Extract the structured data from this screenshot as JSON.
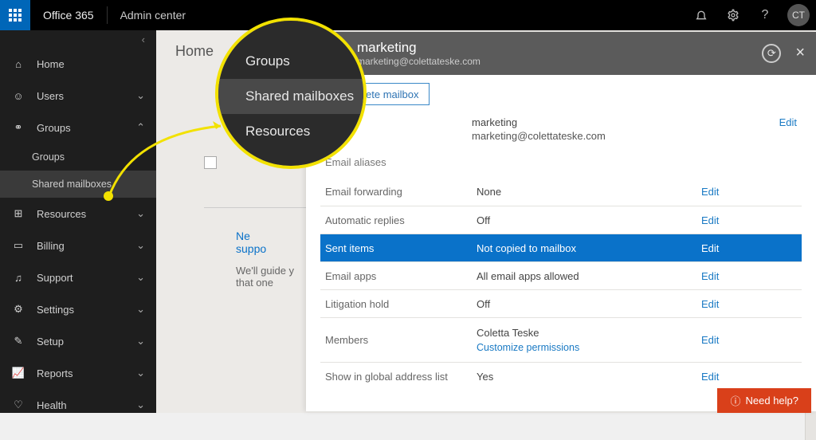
{
  "topbar": {
    "brand": "Office 365",
    "subtitle": "Admin center",
    "avatar_initials": "CT"
  },
  "sidebar": {
    "items": [
      {
        "icon": "home-icon",
        "label": "Home",
        "expandable": false
      },
      {
        "icon": "users-icon",
        "label": "Users",
        "expandable": true,
        "expanded": false
      },
      {
        "icon": "groups-icon",
        "label": "Groups",
        "expandable": true,
        "expanded": true,
        "children": [
          {
            "label": "Groups",
            "selected": false
          },
          {
            "label": "Shared mailboxes",
            "selected": true
          }
        ]
      },
      {
        "icon": "resources-icon",
        "label": "Resources",
        "expandable": true
      },
      {
        "icon": "billing-icon",
        "label": "Billing",
        "expandable": true
      },
      {
        "icon": "support-icon",
        "label": "Support",
        "expandable": true
      },
      {
        "icon": "settings-icon",
        "label": "Settings",
        "expandable": true
      },
      {
        "icon": "setup-icon",
        "label": "Setup",
        "expandable": true
      },
      {
        "icon": "reports-icon",
        "label": "Reports",
        "expandable": true
      },
      {
        "icon": "health-icon",
        "label": "Health",
        "expandable": true
      }
    ]
  },
  "breadcrumb": {
    "root": "Home"
  },
  "helper": {
    "line1": "Ne",
    "line2": "suppo",
    "text": "We'll guide y\nthat one"
  },
  "flyout": {
    "title": "marketing",
    "email": "marketing@colettateske.com",
    "delete_label": "Delete mailbox",
    "name_label": "marketing",
    "name_email": "marketing@colettateske.com",
    "edit_label": "Edit",
    "aliases_label": "Email aliases",
    "rows": [
      {
        "label": "Email forwarding",
        "value": "None",
        "action": "Edit",
        "active": false
      },
      {
        "label": "Automatic replies",
        "value": "Off",
        "action": "Edit",
        "active": false
      },
      {
        "label": "Sent items",
        "value": "Not copied to mailbox",
        "action": "Edit",
        "active": true
      },
      {
        "label": "Email apps",
        "value": "All email apps allowed",
        "action": "Edit",
        "active": false
      },
      {
        "label": "Litigation hold",
        "value": "Off",
        "action": "Edit",
        "active": false
      },
      {
        "label": "Members",
        "value": "Coletta Teske",
        "sub": "Customize permissions",
        "action": "Edit",
        "active": false
      },
      {
        "label": "Show in global address list",
        "value": "Yes",
        "action": "Edit",
        "active": false
      }
    ]
  },
  "zoom": {
    "items": [
      {
        "label": "Groups",
        "selected": false
      },
      {
        "label": "Shared mailboxes",
        "selected": true
      },
      {
        "label": "Resources",
        "selected": false
      }
    ]
  },
  "need_help": {
    "label": "Need help?"
  }
}
